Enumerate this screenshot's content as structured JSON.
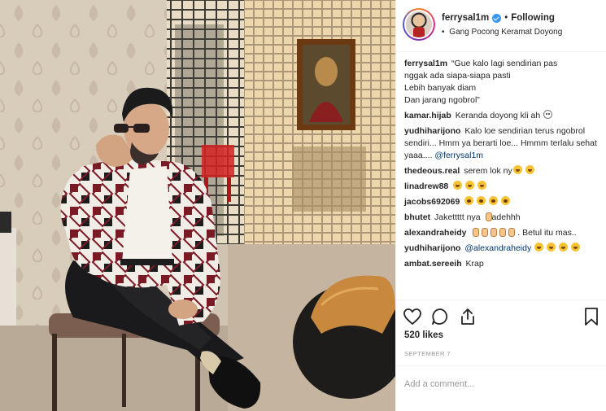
{
  "colors": {
    "accent": "#3897f0",
    "mention": "#003569",
    "muted": "#999999",
    "border": "#efefef"
  },
  "photo": {
    "alt_icon": "post-photo"
  },
  "header": {
    "username": "ferrysal1m",
    "separator": "•",
    "follow_label": "Following",
    "location_sep": "•",
    "location": "Gang Pocong Keramat Doyong"
  },
  "comments": [
    {
      "user": "ferrysal1m",
      "lines": [
        "“Gue kalo lagi sendirian pas",
        "nggak ada siapa-siapa pasti",
        "Lebih banyak diam",
        "Dan jarang ngobrol”"
      ]
    },
    {
      "user": "kamar.hijab",
      "text": "Keranda doyong kli ah"
    },
    {
      "user": "yudhiharijono",
      "text": "Kalo loe sendirian terus ngobrol sendiri... Hmm ya berarti loe... Hmmm terlalu sehat yaaa....",
      "mention": "@ferrysal1m"
    },
    {
      "user": "thedeous.real",
      "text": "serem lok ny"
    },
    {
      "user": "linadrew88",
      "text": ""
    },
    {
      "user": "jacobs692069",
      "text": ""
    },
    {
      "user": "bhutet",
      "text": "Jakettttt nya",
      "text2": "adehhh"
    },
    {
      "user": "alexandraheidy",
      "text": ". Betul itu mas.."
    },
    {
      "user": "yudhiharijono",
      "text": "",
      "mention": "@alexandraheidy"
    },
    {
      "user": "ambat.sereeih",
      "text": "Krap"
    }
  ],
  "actions": {
    "like_icon": "heart-icon",
    "comment_icon": "comment-icon",
    "share_icon": "share-icon",
    "save_icon": "bookmark-icon"
  },
  "likes": "520 likes",
  "date": "SEPTEMBER 7",
  "add_comment": {
    "placeholder": "Add a comment..."
  }
}
